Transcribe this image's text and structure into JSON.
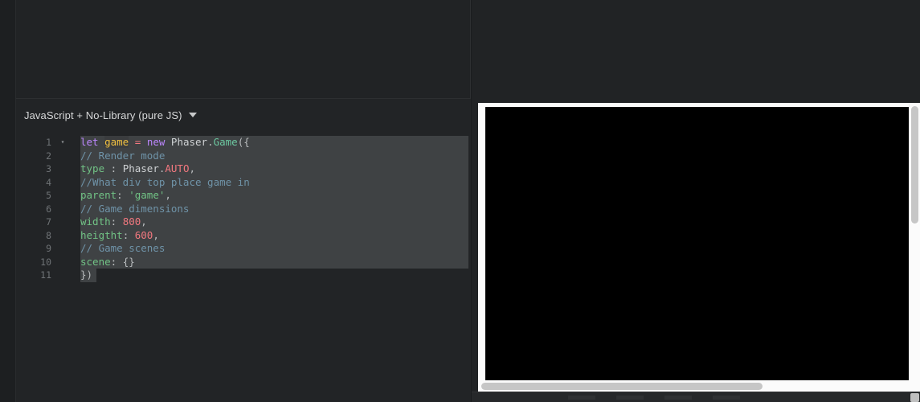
{
  "window": {
    "background_color": "#212325",
    "accent_color": "#bb86fc"
  },
  "editor": {
    "language_selector": {
      "label": "JavaScript + No-Library (pure JS)",
      "caret_icon": "chevron-down-icon"
    },
    "fold_marker": "▾",
    "gutter_line_numbers": [
      "1",
      "2",
      "3",
      "4",
      "5",
      "6",
      "7",
      "8",
      "9",
      "10",
      "11"
    ],
    "lines": [
      {
        "number": "1",
        "has_fold": true,
        "selected": true,
        "tokens": [
          {
            "text": "let",
            "cls": "t-kw"
          },
          {
            "text": " ",
            "cls": "t-plain"
          },
          {
            "text": "game",
            "cls": "t-var-hl"
          },
          {
            "text": " ",
            "cls": "t-plain"
          },
          {
            "text": "=",
            "cls": "t-op"
          },
          {
            "text": " ",
            "cls": "t-plain"
          },
          {
            "text": "new",
            "cls": "t-kw"
          },
          {
            "text": " Phaser",
            "cls": "t-plain"
          },
          {
            "text": ".",
            "cls": "t-punct"
          },
          {
            "text": "Game",
            "cls": "t-class"
          },
          {
            "text": "({",
            "cls": "t-punct"
          }
        ]
      },
      {
        "number": "2",
        "has_fold": false,
        "selected": true,
        "tokens": [
          {
            "text": "// Render mode",
            "cls": "t-comment"
          }
        ]
      },
      {
        "number": "3",
        "has_fold": false,
        "selected": true,
        "tokens": [
          {
            "text": "type",
            "cls": "t-prop"
          },
          {
            "text": " : ",
            "cls": "t-punct"
          },
          {
            "text": "Phaser",
            "cls": "t-plain"
          },
          {
            "text": ".",
            "cls": "t-punct"
          },
          {
            "text": "AUTO",
            "cls": "t-const"
          },
          {
            "text": ",",
            "cls": "t-punct"
          }
        ]
      },
      {
        "number": "4",
        "has_fold": false,
        "selected": true,
        "tokens": [
          {
            "text": "//What div top place game in",
            "cls": "t-comment"
          }
        ]
      },
      {
        "number": "5",
        "has_fold": false,
        "selected": true,
        "tokens": [
          {
            "text": "parent",
            "cls": "t-prop"
          },
          {
            "text": ": ",
            "cls": "t-punct"
          },
          {
            "text": "'game'",
            "cls": "t-str"
          },
          {
            "text": ",",
            "cls": "t-punct"
          }
        ]
      },
      {
        "number": "6",
        "has_fold": false,
        "selected": true,
        "tokens": [
          {
            "text": "// Game dimensions",
            "cls": "t-comment"
          }
        ]
      },
      {
        "number": "7",
        "has_fold": false,
        "selected": true,
        "tokens": [
          {
            "text": "width",
            "cls": "t-prop"
          },
          {
            "text": ": ",
            "cls": "t-punct"
          },
          {
            "text": "800",
            "cls": "t-num"
          },
          {
            "text": ",",
            "cls": "t-punct"
          }
        ]
      },
      {
        "number": "8",
        "has_fold": false,
        "selected": true,
        "tokens": [
          {
            "text": "heigtht",
            "cls": "t-prop"
          },
          {
            "text": ": ",
            "cls": "t-punct"
          },
          {
            "text": "600",
            "cls": "t-num"
          },
          {
            "text": ",",
            "cls": "t-punct"
          }
        ]
      },
      {
        "number": "9",
        "has_fold": false,
        "selected": true,
        "tokens": [
          {
            "text": "// Game scenes",
            "cls": "t-comment"
          }
        ]
      },
      {
        "number": "10",
        "has_fold": false,
        "selected": true,
        "tokens": [
          {
            "text": "scene",
            "cls": "t-prop"
          },
          {
            "text": ": ",
            "cls": "t-punct"
          },
          {
            "text": "{}",
            "cls": "t-punct"
          }
        ]
      },
      {
        "number": "11",
        "has_fold": false,
        "selected": true,
        "selection_width": 20,
        "tokens": [
          {
            "text": "})",
            "cls": "t-punct"
          }
        ]
      }
    ],
    "plain_text": "let game = new Phaser.Game({\n// Render mode\ntype : Phaser.AUTO,\n//What div top place game in\nparent: 'game',\n// Game dimensions\nwidth: 800,\nheigtht: 600,\n// Game scenes\nscene: {}\n})"
  },
  "preview": {
    "canvas_color": "#000000",
    "page_background": "#fbfbfb",
    "vertical_scrollbar": "vertical-scrollbar",
    "horizontal_scrollbar": "horizontal-scrollbar"
  },
  "status_bar": {
    "items": [
      "",
      "",
      "",
      ""
    ],
    "resize_handle": "resize-handle-icon"
  }
}
